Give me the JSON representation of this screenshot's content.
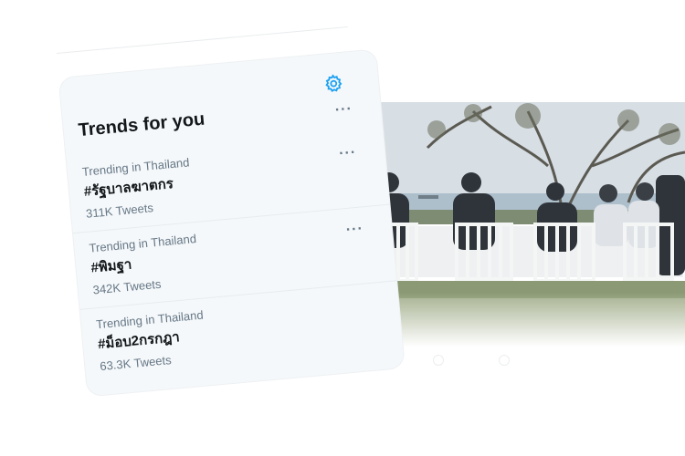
{
  "trends_panel": {
    "title": "Trends for you",
    "settings_icon": "gear-icon",
    "more_icon": "more-dots-icon",
    "accent_color": "#1da1f2",
    "items": [
      {
        "context": "Trending in Thailand",
        "tag": "#รัฐบาลฆาตกร",
        "count": "311K Tweets"
      },
      {
        "context": "Trending in Thailand",
        "tag": "#พิมฐา",
        "count": "342K Tweets"
      },
      {
        "context": "Trending in Thailand",
        "tag": "#ม็อบ2กรกฎา",
        "count": "63.3K Tweets"
      }
    ]
  },
  "background_photo": {
    "subject": "people-seated-at-outdoor-table"
  }
}
